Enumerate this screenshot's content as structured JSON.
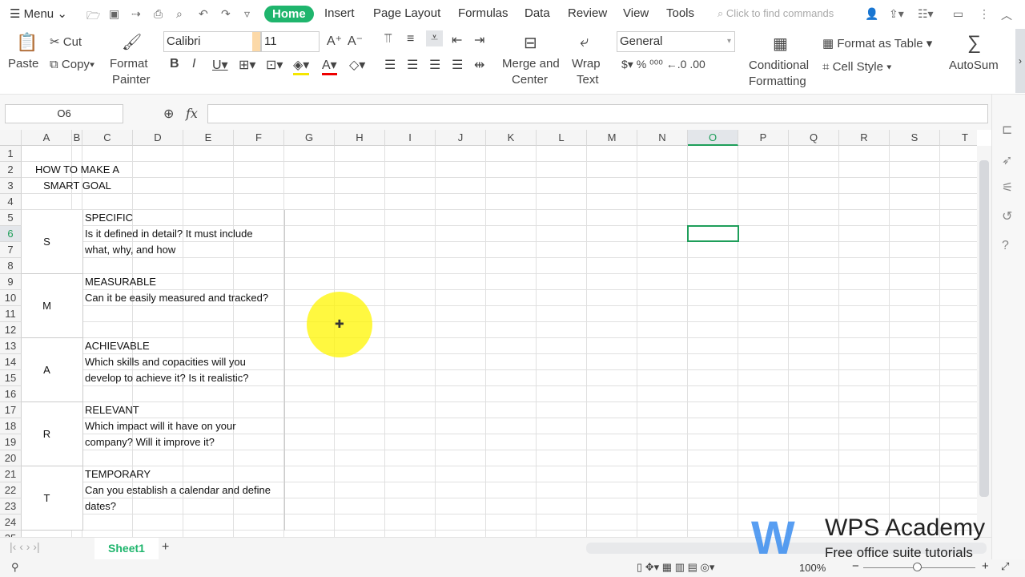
{
  "menu": {
    "menu_label": "Menu",
    "tabs": [
      "Home",
      "Insert",
      "Page Layout",
      "Formulas",
      "Data",
      "Review",
      "View",
      "Tools"
    ],
    "search_placeholder": "Click to find commands"
  },
  "ribbon": {
    "paste": "Paste",
    "cut": "Cut",
    "copy": "Copy",
    "format_painter_1": "Format",
    "format_painter_2": "Painter",
    "font": "Calibri",
    "size": "11",
    "merge_1": "Merge and",
    "merge_2": "Center",
    "wrap_1": "Wrap",
    "wrap_2": "Text",
    "number_format": "General",
    "cond_1": "Conditional",
    "cond_2": "Formatting",
    "format_table": "Format as Table",
    "cell_style": "Cell Style",
    "autosum": "AutoSum"
  },
  "formula_bar": {
    "name_box": "O6",
    "fx": "fx",
    "value": ""
  },
  "columns": [
    "A",
    "B",
    "C",
    "D",
    "E",
    "F",
    "G",
    "H",
    "I",
    "J",
    "K",
    "L",
    "M",
    "N",
    "O",
    "P",
    "Q",
    "R",
    "S",
    "T"
  ],
  "selected_cell": "O6",
  "cells": {
    "title1": "HOW TO MAKE A",
    "title2": "SMART GOAL",
    "s": "S",
    "s_head": "SPECIFIC",
    "s_1": "Is it defined in detail? It must include",
    "s_2": "what, why, and how",
    "m": "M",
    "m_head": "MEASURABLE",
    "m_1": " Can it be easily measured and tracked?",
    "a": "A",
    "a_head": "ACHIEVABLE",
    "a_1": "Which skills and copacities will you",
    "a_2": "develop to achieve it? Is it realistic?",
    "r": "R",
    "r_head": "RELEVANT",
    "r_1": "Which impact will it have on your",
    "r_2": "company? Will it improve it?",
    "t": "T",
    "t_head": "TEMPORARY",
    "t_1": "Can you establish a calendar and define",
    "t_2": "dates?"
  },
  "sheet_tab": "Sheet1",
  "status": {
    "zoom": "100%"
  },
  "watermark": {
    "title": "WPS Academy",
    "subtitle": "Free office suite tutorials"
  },
  "colors": {
    "accent": "#1fb56d",
    "selection": "#1e9e5a"
  }
}
